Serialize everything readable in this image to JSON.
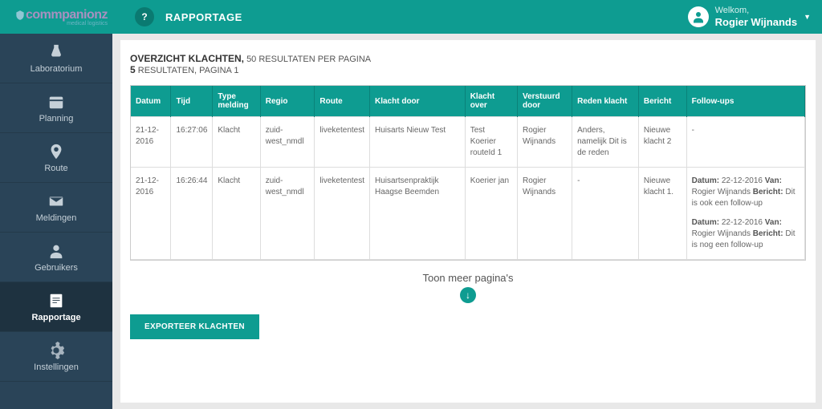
{
  "brand": {
    "name": "commpanionz",
    "tagline": "medical logistics"
  },
  "header": {
    "title": "RAPPORTAGE",
    "welcome": "Welkom,",
    "username": "Rogier Wijnands"
  },
  "nav": {
    "items": [
      {
        "label": "Laboratorium",
        "active": false
      },
      {
        "label": "Planning",
        "active": false
      },
      {
        "label": "Route",
        "active": false
      },
      {
        "label": "Meldingen",
        "active": false
      },
      {
        "label": "Gebruikers",
        "active": false
      },
      {
        "label": "Rapportage",
        "active": true
      },
      {
        "label": "Instellingen",
        "active": false
      }
    ]
  },
  "overview": {
    "title": "OVERZICHT KLACHTEN,",
    "perpage": "50 RESULTATEN PER PAGINA",
    "count": "5",
    "countLabel": "RESULTATEN, PAGINA 1"
  },
  "table": {
    "headers": [
      "Datum",
      "Tijd",
      "Type melding",
      "Regio",
      "Route",
      "Klacht door",
      "Klacht over",
      "Verstuurd door",
      "Reden klacht",
      "Bericht",
      "Follow-ups"
    ],
    "rows": [
      {
        "datum": "21-12-2016",
        "tijd": "16:27:06",
        "type": "Klacht",
        "regio": "zuid-west_nmdl",
        "route": "liveketentest",
        "klachtdoor": "Huisarts Nieuw Test",
        "klachtover": "Test Koerier routeId 1",
        "verstuurd": "Rogier Wijnands",
        "reden": "Anders, namelijk Dit is de reden",
        "bericht": "Nieuwe klacht 2",
        "followups": []
      },
      {
        "datum": "21-12-2016",
        "tijd": "16:26:44",
        "type": "Klacht",
        "regio": "zuid-west_nmdl",
        "route": "liveketentest",
        "klachtdoor": "Huisartsenpraktijk Haagse Beemden",
        "klachtover": "Koerier jan",
        "verstuurd": "Rogier Wijnands",
        "reden": "-",
        "bericht": "Nieuwe klacht 1.",
        "followups": [
          {
            "datum": "22-12-2016",
            "van": "Rogier Wijnands",
            "bericht": "Dit is ook een follow-up"
          },
          {
            "datum": "22-12-2016",
            "van": "Rogier Wijnands",
            "bericht": "Dit is nog een follow-up"
          }
        ]
      }
    ]
  },
  "actions": {
    "showMore": "Toon meer pagina's",
    "export": "EXPORTEER KLACHTEN"
  },
  "labels": {
    "fuDatum": "Datum:",
    "fuVan": "Van:",
    "fuBericht": "Bericht:"
  }
}
